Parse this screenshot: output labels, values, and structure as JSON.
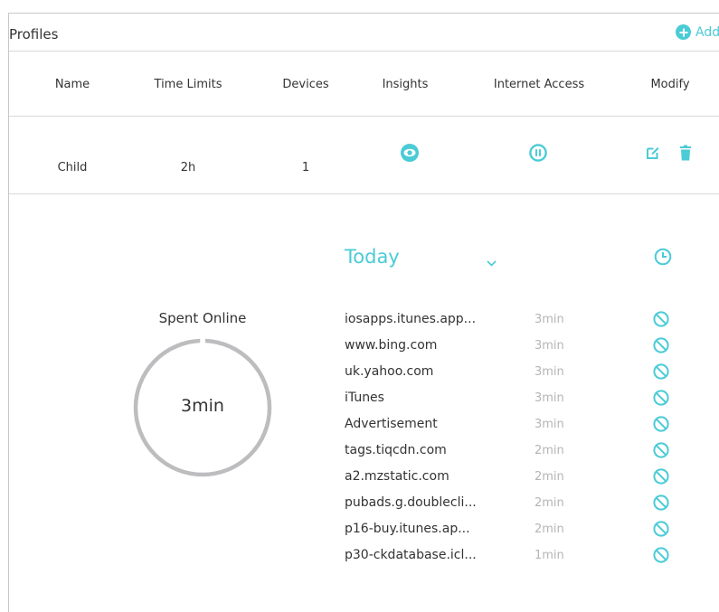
{
  "profiles": {
    "title": "Profiles",
    "add_label": "Add",
    "columns": [
      "Name",
      "Time Limits",
      "Devices",
      "Insights",
      "Internet Access",
      "Modify"
    ],
    "rows": [
      {
        "name": "Child",
        "time_limit": "2h",
        "devices": "1",
        "insights_icon": "eye-icon",
        "internet_access_icon": "pause-icon",
        "modify_icons": [
          "edit-icon",
          "trash-icon"
        ]
      }
    ]
  },
  "insights": {
    "spent_online_label": "Spent Online",
    "spent_online_value": "3min",
    "period": "Today",
    "sites": [
      {
        "name": "iosapps.itunes.app...",
        "time": "3min"
      },
      {
        "name": "www.bing.com",
        "time": "3min"
      },
      {
        "name": "uk.yahoo.com",
        "time": "3min"
      },
      {
        "name": "iTunes",
        "time": "3min"
      },
      {
        "name": "Advertisement",
        "time": "3min"
      },
      {
        "name": "tags.tiqcdn.com",
        "time": "2min"
      },
      {
        "name": "a2.mzstatic.com",
        "time": "2min"
      },
      {
        "name": "pubads.g.doublecli...",
        "time": "2min"
      },
      {
        "name": "p16-buy.itunes.ap...",
        "time": "2min"
      },
      {
        "name": "p30-ckdatabase.icl...",
        "time": "1min"
      }
    ]
  },
  "colors": {
    "accent": "#4acbd6",
    "ring": "#bdbdc0",
    "muted_text": "#b5b5b5"
  }
}
